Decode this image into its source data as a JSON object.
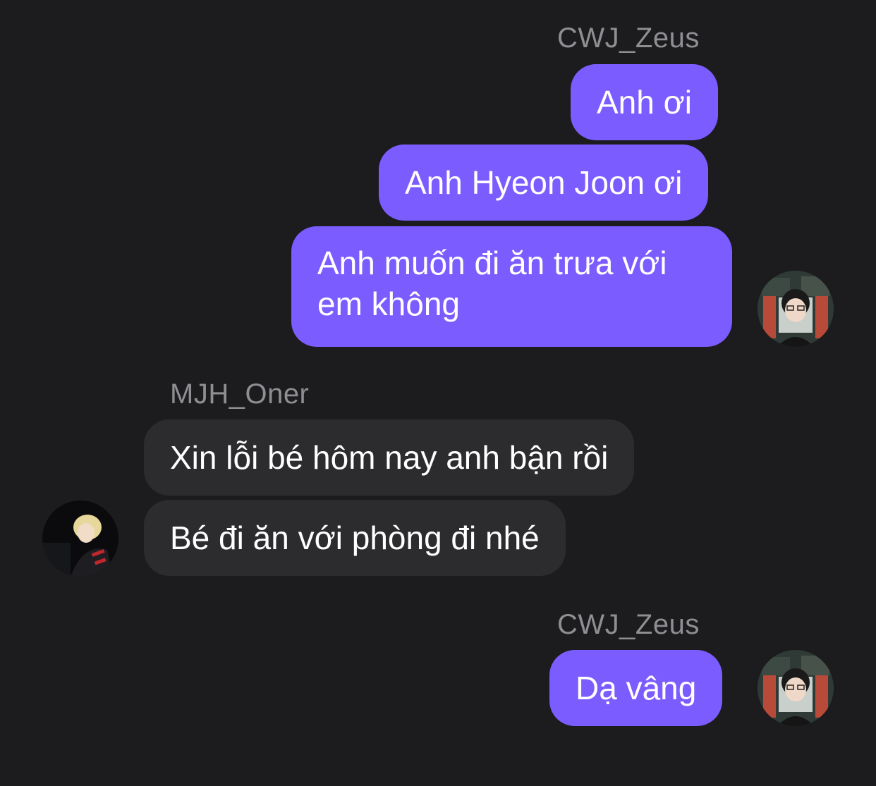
{
  "conversation": [
    {
      "sender": "CWJ_Zeus",
      "direction": "outgoing",
      "messages": [
        "Anh ơi",
        "Anh Hyeon Joon ơi",
        "Anh muốn đi ăn trưa với em không"
      ],
      "avatar": "zeus-avatar"
    },
    {
      "sender": "MJH_Oner",
      "direction": "incoming",
      "messages": [
        "Xin lỗi bé hôm nay anh bận rồi",
        "Bé đi ăn với phòng đi nhé"
      ],
      "avatar": "oner-avatar"
    },
    {
      "sender": "CWJ_Zeus",
      "direction": "outgoing",
      "messages": [
        "Dạ vâng"
      ],
      "avatar": "zeus-avatar"
    }
  ],
  "colors": {
    "background": "#1c1c1e",
    "outgoing_bubble": "#7b5cff",
    "incoming_bubble": "#2c2c2e",
    "sender_name": "#8e8e93",
    "message_text": "#ffffff"
  }
}
